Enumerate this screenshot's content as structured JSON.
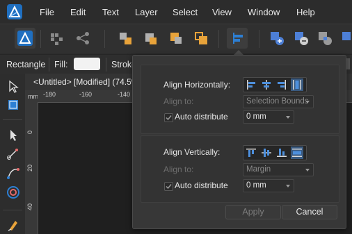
{
  "menu": [
    "File",
    "Edit",
    "Text",
    "Layer",
    "Select",
    "View",
    "Window",
    "Help"
  ],
  "context_toolbar": {
    "shape_name": "Rectangle",
    "fill_label": "Fill:",
    "stroke_label": "Stroke"
  },
  "document": {
    "tab_title": "<Untitled> [Modified] (74.5%"
  },
  "ruler": {
    "unit": "mm",
    "h_ticks": [
      "-180",
      "-160",
      "-140"
    ],
    "v_ticks": [
      "0",
      "20",
      "40"
    ]
  },
  "align_popover": {
    "horizontal": {
      "title": "Align Horizontally:",
      "align_to_label": "Align to:",
      "align_to_value": "Selection Bounds",
      "auto_distribute_label": "Auto distribute",
      "auto_distribute_checked": true,
      "distribute_value": "0 mm",
      "icons": [
        "align-left-icon",
        "align-center-icon",
        "align-right-icon",
        "distribute-horizontal-icon"
      ]
    },
    "vertical": {
      "title": "Align Vertically:",
      "align_to_label": "Align to:",
      "align_to_value": "Margin",
      "auto_distribute_label": "Auto distribute",
      "auto_distribute_checked": true,
      "distribute_value": "0 mm",
      "icons": [
        "align-top-icon",
        "align-middle-icon",
        "align-bottom-icon",
        "distribute-vertical-icon"
      ]
    },
    "apply_label": "Apply",
    "cancel_label": "Cancel"
  },
  "colors": {
    "accent": "#2d7fd3",
    "orange": "#e8a33a",
    "background": "#2b2b2b"
  }
}
